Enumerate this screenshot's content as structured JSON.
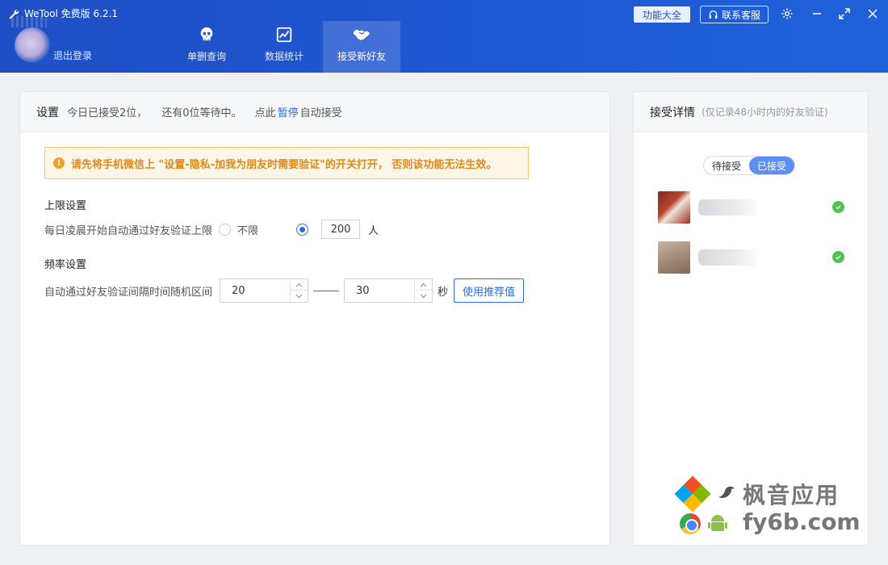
{
  "header": {
    "app_title": "WeTool 免费版 6.2.1",
    "logout_label": "退出登录",
    "nav": [
      {
        "label": "单删查询",
        "icon": "skull-icon"
      },
      {
        "label": "数据统计",
        "icon": "chart-icon"
      },
      {
        "label": "接受新好友",
        "icon": "handshake-icon",
        "active": true
      }
    ],
    "features_label": "功能大全",
    "service_label": "联系客服",
    "accent_color": "#1f4fc6"
  },
  "settings": {
    "title": "设置",
    "status_part1": "今日已接受2位，",
    "status_part2": "还有0位等待中。",
    "status_part3": "点此",
    "pause_link": "暂停",
    "status_part4": "自动接受",
    "warning": "请先将手机微信上 \"设置-隐私-加我为朋友时需要验证\"的开关打开， 否则该功能无法生效。",
    "limit_section": "上限设置",
    "limit_label": "每日凌晨开始自动通过好友验证上限",
    "unlimited_label": "不限",
    "limit_value": "200",
    "limit_unit": "人",
    "freq_section": "频率设置",
    "freq_label": "自动通过好友验证间隔时间随机区间",
    "freq_min": "20",
    "freq_max": "30",
    "freq_unit": "秒",
    "recommend_label": "使用推荐值"
  },
  "details": {
    "title": "接受详情",
    "subtitle": "(仅记录48小时内的好友验证)",
    "tab_pending": "待接受",
    "tab_accepted": "已接受",
    "active_tab": "已接受"
  },
  "watermark": {
    "line1": "枫音应用",
    "line2": "fy6b.com"
  }
}
